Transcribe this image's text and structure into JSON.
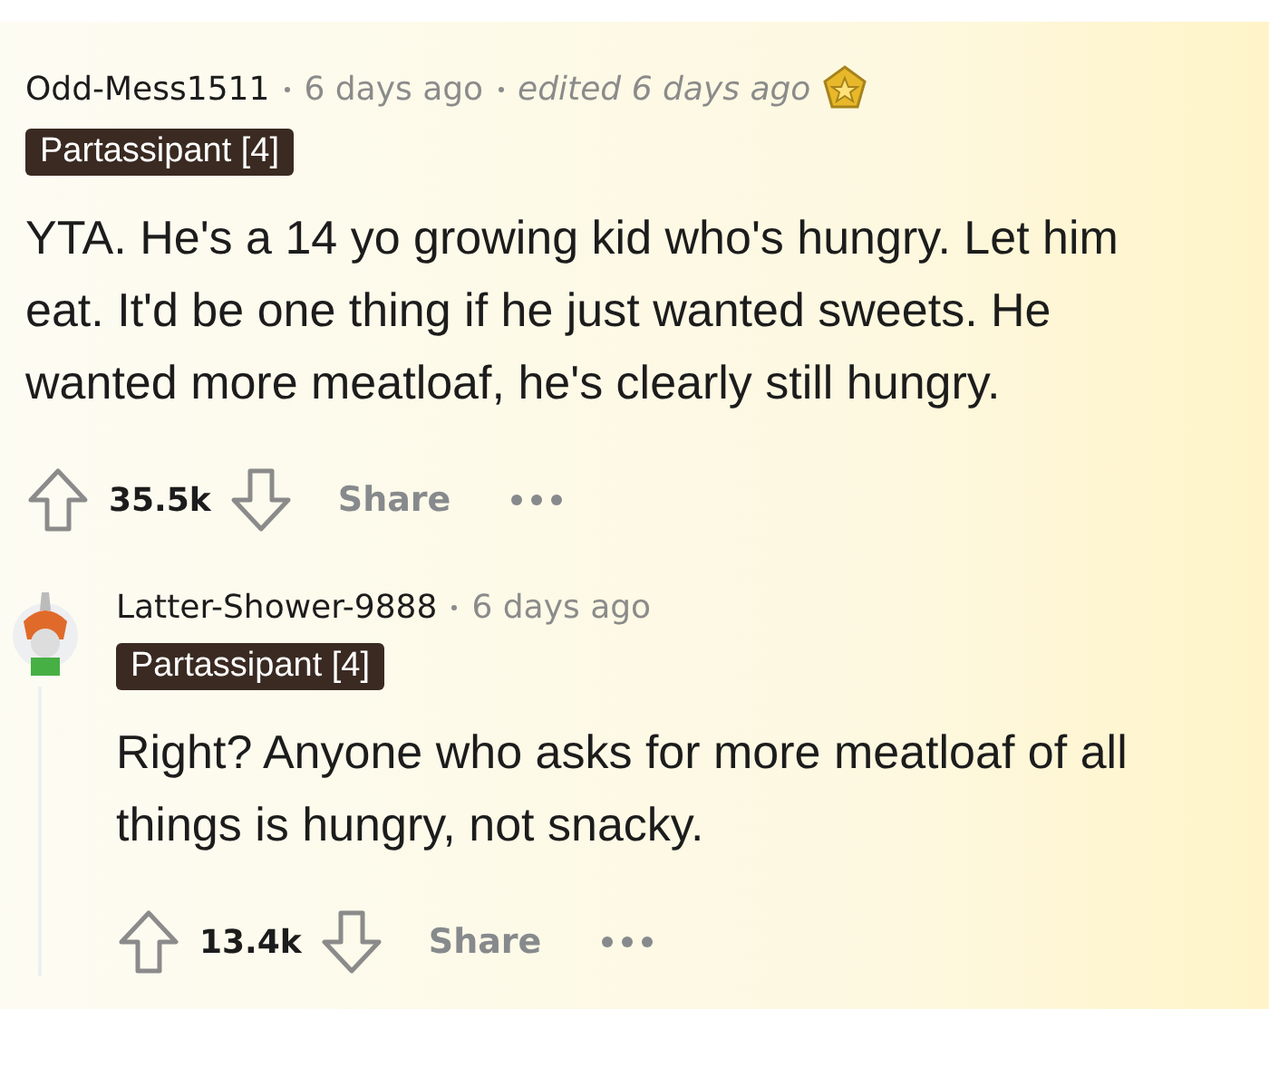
{
  "comment": {
    "author": "Odd-Mess1511",
    "age": "6 days ago",
    "edited": "edited 6 days ago",
    "highlighted": true,
    "flair": "Partassipant [4]",
    "body": "YTA. He's a 14 yo growing kid who's hungry. Let him eat. It'd be one thing if he just wanted sweets. He wanted more meatloaf, he's clearly still hungry.",
    "score": "35.5k",
    "share": "Share",
    "replies": [
      {
        "author": "Latter-Shower-9888",
        "age": "6 days ago",
        "highlighted": false,
        "flair": "Partassipant [4]",
        "body": "Right? Anyone who asks for more meatloaf of all things is hungry, not snacky.",
        "score": "13.4k",
        "share": "Share"
      }
    ]
  }
}
